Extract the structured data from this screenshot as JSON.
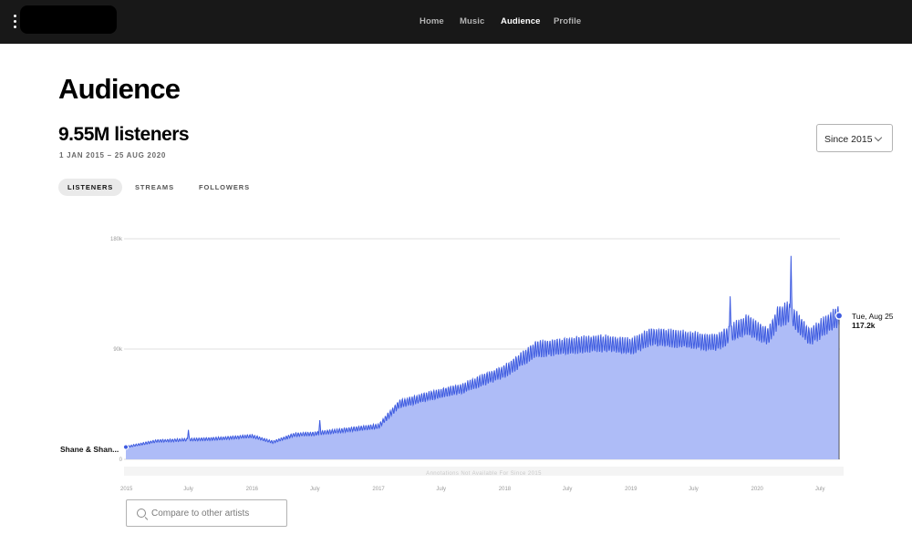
{
  "header": {
    "menu_icon": "kebab-vertical-icon",
    "nav": [
      {
        "label": "Home",
        "active": false
      },
      {
        "label": "Music",
        "active": false
      },
      {
        "label": "Audience",
        "active": true
      },
      {
        "label": "Profile",
        "active": false
      }
    ]
  },
  "page": {
    "title": "Audience",
    "listeners_total": "9.55M listeners",
    "date_range": "1 JAN 2015 – 25 AUG 2020"
  },
  "range_select": {
    "value": "Since 2015",
    "icon": "chevron-down-icon"
  },
  "tabs": [
    {
      "label": "LISTENERS",
      "active": true
    },
    {
      "label": "STREAMS",
      "active": false
    },
    {
      "label": "FOLLOWERS",
      "active": false
    }
  ],
  "chart_data": {
    "type": "area",
    "y_ticks": [
      "180k",
      "90k",
      "0"
    ],
    "x_ticks": [
      "2015",
      "July",
      "2016",
      "July",
      "2017",
      "July",
      "2018",
      "July",
      "2019",
      "July",
      "2020",
      "July"
    ],
    "ylim": [
      0,
      180000
    ],
    "grid": true,
    "series": [
      {
        "name": "Shane & Shan...",
        "color": "#3f5ce0",
        "fill": "#aebcf7",
        "x_start": "2015-01-01",
        "x_end": "2020-08-25",
        "anchors": [
          [
            "2015-01-01",
            10000
          ],
          [
            "2015-04-01",
            15000
          ],
          [
            "2015-10-01",
            17000
          ],
          [
            "2016-01-01",
            19000
          ],
          [
            "2016-03-01",
            14000
          ],
          [
            "2016-05-01",
            20000
          ],
          [
            "2016-07-01",
            21000
          ],
          [
            "2017-01-01",
            27000
          ],
          [
            "2017-03-01",
            45000
          ],
          [
            "2017-06-01",
            52000
          ],
          [
            "2017-09-01",
            58000
          ],
          [
            "2018-01-01",
            72000
          ],
          [
            "2018-04-01",
            90000
          ],
          [
            "2018-10-01",
            95000
          ],
          [
            "2019-01-01",
            92000
          ],
          [
            "2019-03-01",
            100000
          ],
          [
            "2019-06-01",
            98000
          ],
          [
            "2019-09-01",
            95000
          ],
          [
            "2019-12-01",
            110000
          ],
          [
            "2020-02-01",
            100000
          ],
          [
            "2020-03-01",
            116000
          ],
          [
            "2020-04-01",
            120000
          ],
          [
            "2020-06-01",
            100000
          ],
          [
            "2020-08-25",
            117200
          ]
        ],
        "spikes": [
          [
            "2015-07-01",
            24000
          ],
          [
            "2016-07-15",
            32000
          ],
          [
            "2019-10-15",
            133000
          ],
          [
            "2020-04-08",
            166000
          ]
        ]
      }
    ],
    "tooltip": {
      "date": "Tue, Aug 25",
      "value": "117.2k",
      "value_num": 117200
    },
    "annotation_note": "Annotations Not Available For Since 2015"
  },
  "compare": {
    "placeholder": "Compare to other artists",
    "icon": "search-icon"
  }
}
